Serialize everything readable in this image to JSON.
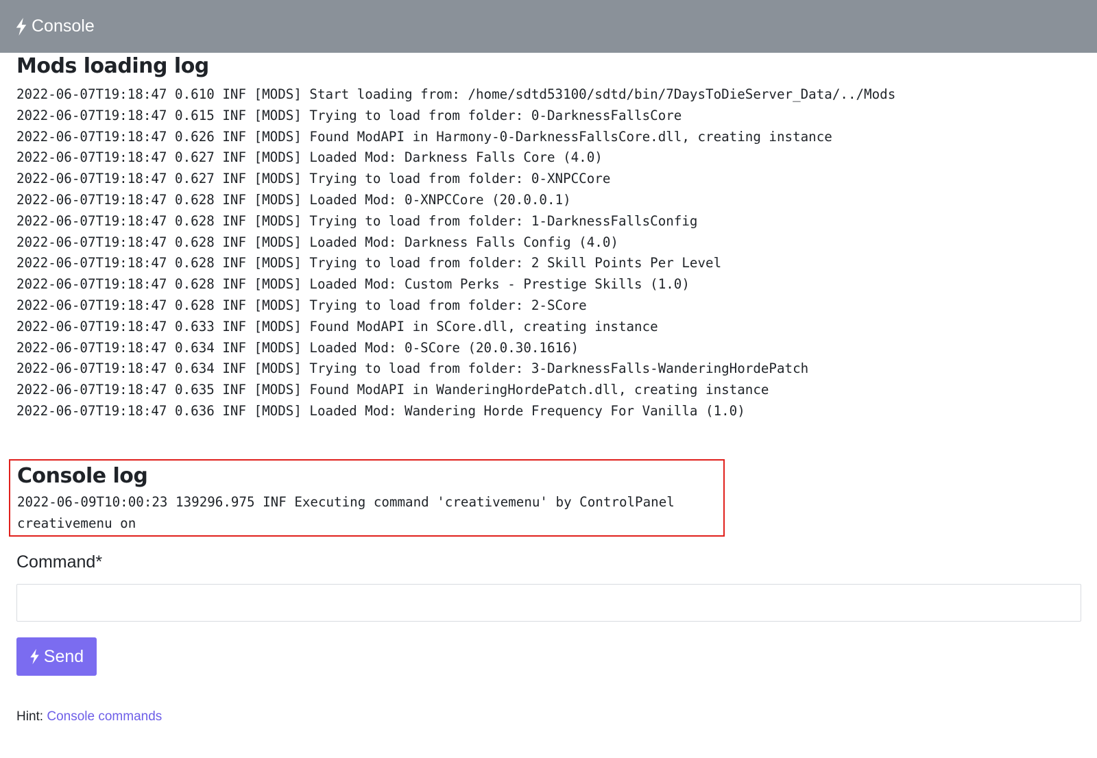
{
  "header": {
    "title": "Console",
    "icon": "bolt-icon"
  },
  "mods_section": {
    "title": "Mods loading log",
    "lines": [
      "2022-06-07T19:18:47 0.610 INF [MODS] Start loading from: /home/sdtd53100/sdtd/bin/7DaysToDieServer_Data/../Mods",
      "2022-06-07T19:18:47 0.615 INF [MODS] Trying to load from folder: 0-DarknessFallsCore",
      "2022-06-07T19:18:47 0.626 INF [MODS] Found ModAPI in Harmony-0-DarknessFallsCore.dll, creating instance",
      "2022-06-07T19:18:47 0.627 INF [MODS] Loaded Mod: Darkness Falls Core (4.0)",
      "2022-06-07T19:18:47 0.627 INF [MODS] Trying to load from folder: 0-XNPCCore",
      "2022-06-07T19:18:47 0.628 INF [MODS] Loaded Mod: 0-XNPCCore (20.0.0.1)",
      "2022-06-07T19:18:47 0.628 INF [MODS] Trying to load from folder: 1-DarknessFallsConfig",
      "2022-06-07T19:18:47 0.628 INF [MODS] Loaded Mod: Darkness Falls Config (4.0)",
      "2022-06-07T19:18:47 0.628 INF [MODS] Trying to load from folder: 2 Skill Points Per Level",
      "2022-06-07T19:18:47 0.628 INF [MODS] Loaded Mod: Custom Perks - Prestige Skills (1.0)",
      "2022-06-07T19:18:47 0.628 INF [MODS] Trying to load from folder: 2-SCore",
      "2022-06-07T19:18:47 0.633 INF [MODS] Found ModAPI in SCore.dll, creating instance",
      "2022-06-07T19:18:47 0.634 INF [MODS] Loaded Mod: 0-SCore (20.0.30.1616)",
      "2022-06-07T19:18:47 0.634 INF [MODS] Trying to load from folder: 3-DarknessFalls-WanderingHordePatch",
      "2022-06-07T19:18:47 0.635 INF [MODS] Found ModAPI in WanderingHordePatch.dll, creating instance",
      "2022-06-07T19:18:47 0.636 INF [MODS] Loaded Mod: Wandering Horde Frequency For Vanilla (1.0)"
    ]
  },
  "console_section": {
    "title": "Console log",
    "lines": [
      "2022-06-09T10:00:23 139296.975 INF Executing command 'creativemenu' by ControlPanel",
      "creativemenu on"
    ],
    "highlight_color": "#e0201c"
  },
  "command_form": {
    "label": "Command*",
    "value": "",
    "placeholder": "",
    "send_label": "Send",
    "send_color": "#7b6cf0"
  },
  "hint": {
    "prefix": "Hint:",
    "link_text": "Console commands"
  }
}
